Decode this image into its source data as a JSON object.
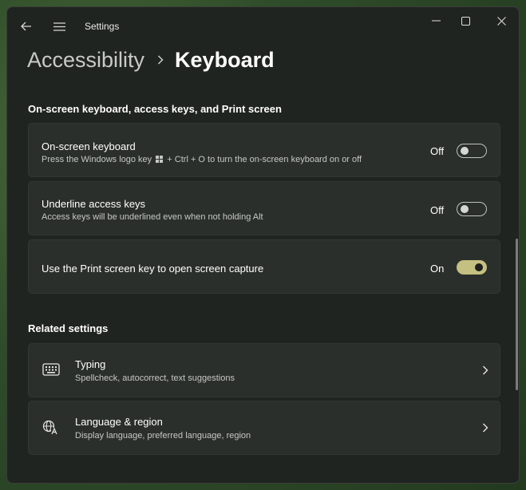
{
  "window": {
    "title": "Settings"
  },
  "breadcrumb": {
    "parent": "Accessibility",
    "current": "Keyboard"
  },
  "section_keyboard": {
    "heading": "On-screen keyboard, access keys, and Print screen",
    "items": [
      {
        "title": "On-screen keyboard",
        "desc_before": "Press the Windows logo key",
        "desc_after": "+ Ctrl + O to turn the on-screen keyboard on or off",
        "state": "Off",
        "enabled": false
      },
      {
        "title": "Underline access keys",
        "desc": "Access keys will be underlined even when not holding Alt",
        "state": "Off",
        "enabled": false
      },
      {
        "title": "Use the Print screen key to open screen capture",
        "state": "On",
        "enabled": true
      }
    ]
  },
  "section_related": {
    "heading": "Related settings",
    "items": [
      {
        "icon": "keyboard-icon",
        "title": "Typing",
        "desc": "Spellcheck, autocorrect, text suggestions"
      },
      {
        "icon": "language-icon",
        "title": "Language & region",
        "desc": "Display language, preferred language, region"
      }
    ]
  },
  "colors": {
    "accent": "#c4c081",
    "window_bg": "#202420",
    "card_bg": "#2b2f2b"
  }
}
